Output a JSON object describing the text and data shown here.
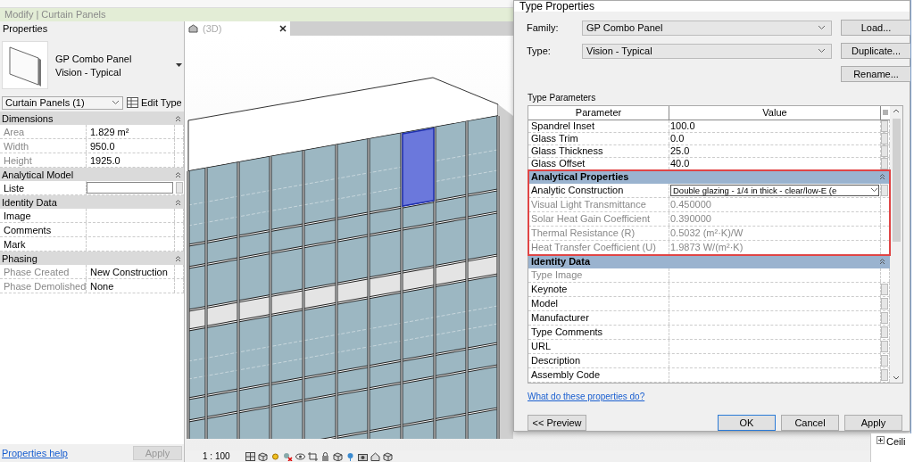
{
  "ribbon": {
    "context_tab": "Modify | Curtain Panels"
  },
  "properties": {
    "title": "Properties",
    "family": "GP Combo Panel",
    "type": "Vision - Typical",
    "filter": "Curtain Panels (1)",
    "edit_type": "Edit Type",
    "groups": [
      {
        "name": "Dimensions",
        "rows": [
          {
            "label": "Area",
            "value": "1.829 m²",
            "disabled": true,
            "kind": "text"
          },
          {
            "label": "Width",
            "value": "950.0",
            "disabled": true,
            "kind": "text"
          },
          {
            "label": "Height",
            "value": "1925.0",
            "disabled": true,
            "kind": "text"
          }
        ]
      },
      {
        "name": "Analytical Model",
        "rows": [
          {
            "label": "Liste",
            "value": "",
            "disabled": false,
            "kind": "field"
          }
        ]
      },
      {
        "name": "Identity Data",
        "rows": [
          {
            "label": "Image",
            "value": "",
            "disabled": false,
            "kind": "text"
          },
          {
            "label": "Comments",
            "value": "",
            "disabled": false,
            "kind": "text"
          },
          {
            "label": "Mark",
            "value": "",
            "disabled": false,
            "kind": "text"
          }
        ]
      },
      {
        "name": "Phasing",
        "rows": [
          {
            "label": "Phase Created",
            "value": "New Construction",
            "disabled": true,
            "kind": "text"
          },
          {
            "label": "Phase Demolished",
            "value": "None",
            "disabled": true,
            "kind": "text"
          }
        ]
      }
    ],
    "help_link": "Properties help",
    "apply": {
      "label": "Apply",
      "disabled": true
    }
  },
  "view": {
    "tab": "(3D)",
    "scale": "1 : 100"
  },
  "dialog": {
    "title": "Type Properties",
    "family_label": "Family:",
    "family": "GP Combo Panel",
    "type_label": "Type:",
    "type": "Vision - Typical",
    "side_buttons": [
      "Load...",
      "Duplicate...",
      "Rename..."
    ],
    "section_label": "Type Parameters",
    "table": {
      "columns": [
        "Parameter",
        "Value"
      ],
      "rows": [
        {
          "label": "Spandrel Inset",
          "value": "100.0",
          "disabled": false,
          "kind": "text"
        },
        {
          "label": "Glass Trim",
          "value": "0.0",
          "disabled": false,
          "kind": "text"
        },
        {
          "label": "Glass Thickness",
          "value": "25.0",
          "disabled": false,
          "kind": "text"
        },
        {
          "label": "Glass Offset",
          "value": "40.0",
          "disabled": false,
          "kind": "text"
        }
      ],
      "groups": [
        {
          "name": "Analytical Properties",
          "highlighted": true,
          "rows": [
            {
              "label": "Analytic Construction",
              "value": "Double glazing - 1/4 in thick - clear/low-E (e",
              "disabled": false,
              "kind": "dropdown"
            },
            {
              "label": "Visual Light Transmittance",
              "value": "0.450000",
              "disabled": true,
              "kind": "text"
            },
            {
              "label": "Solar Heat Gain Coefficient",
              "value": "0.390000",
              "disabled": true,
              "kind": "text"
            },
            {
              "label": "Thermal Resistance (R)",
              "value": "0.5032 (m²·K)/W",
              "disabled": true,
              "kind": "text"
            },
            {
              "label": "Heat Transfer Coefficient (U)",
              "value": "1.9873 W/(m²·K)",
              "disabled": true,
              "kind": "text"
            }
          ]
        },
        {
          "name": "Identity Data",
          "highlighted": false,
          "rows": [
            {
              "label": "Type Image",
              "value": "",
              "disabled": true,
              "kind": "text"
            },
            {
              "label": "Keynote",
              "value": "",
              "disabled": false,
              "kind": "text"
            },
            {
              "label": "Model",
              "value": "",
              "disabled": false,
              "kind": "text"
            },
            {
              "label": "Manufacturer",
              "value": "",
              "disabled": false,
              "kind": "text"
            },
            {
              "label": "Type Comments",
              "value": "",
              "disabled": false,
              "kind": "text"
            },
            {
              "label": "URL",
              "value": "",
              "disabled": false,
              "kind": "text"
            },
            {
              "label": "Description",
              "value": "",
              "disabled": false,
              "kind": "text"
            },
            {
              "label": "Assembly Code",
              "value": "",
              "disabled": false,
              "kind": "text"
            }
          ]
        }
      ]
    },
    "help_link": "What do these properties do?",
    "preview_button": "<< Preview",
    "buttons": [
      {
        "label": "OK",
        "default": true
      },
      {
        "label": "Cancel",
        "default": false
      },
      {
        "label": "Apply",
        "default": false
      }
    ]
  },
  "project_browser": {
    "items": [
      {
        "label": "Ceili"
      }
    ]
  }
}
